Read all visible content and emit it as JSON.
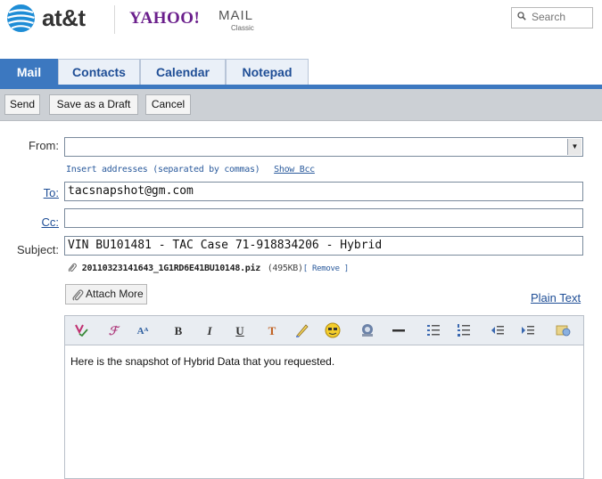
{
  "header": {
    "brand": "at&t",
    "yahoo_logo": "YAHOO!",
    "mail_logo": "MAIL",
    "mail_sub": "Classic",
    "search_placeholder": "Search"
  },
  "tabs": [
    {
      "label": "Mail",
      "active": true
    },
    {
      "label": "Contacts",
      "active": false
    },
    {
      "label": "Calendar",
      "active": false
    },
    {
      "label": "Notepad",
      "active": false
    }
  ],
  "toolbar": {
    "send_label": "Send",
    "draft_label": "Save as a Draft",
    "cancel_label": "Cancel"
  },
  "compose": {
    "from_label": "From:",
    "from_value": "",
    "hint": "Insert addresses (separated by commas)",
    "show_bcc": "Show Bcc",
    "to_label": "To:",
    "to_value": "tacsnapshot@gm.com",
    "cc_label": "Cc:",
    "cc_value": "",
    "subject_label": "Subject:",
    "subject_value": "VIN BU101481 - TAC Case 71-918834206 - Hybrid",
    "attachment_name": "20110323141643_1G1RD6E41BU10148.piz",
    "attachment_size": "(495KB)",
    "attachment_remove": "[ Remove ]",
    "attach_more": "Attach More",
    "plain_text": "Plain Text",
    "body": "Here is the snapshot of Hybrid Data that you requested."
  },
  "editor_tools": [
    "spell-check-icon",
    "font-icon",
    "font-size-icon",
    "bold-icon",
    "italic-icon",
    "underline-icon",
    "text-color-icon",
    "highlight-icon",
    "emoticon-icon",
    "insert-image-icon",
    "horizontal-rule-icon",
    "bulleted-list-icon",
    "numbered-list-icon",
    "outdent-icon",
    "indent-icon",
    "stationery-icon"
  ],
  "colors": {
    "tab_active": "#3c78c0",
    "link": "#1f4e96",
    "yahoo_purple": "#6b1f8c",
    "toolbar_bg": "#ccd0d5"
  }
}
